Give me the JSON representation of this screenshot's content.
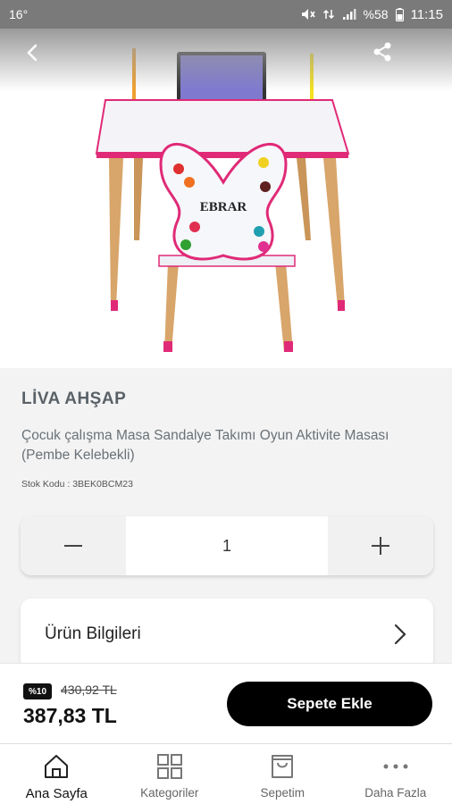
{
  "status_bar": {
    "temperature": "16°",
    "battery": "%58",
    "time": "11:15"
  },
  "product": {
    "brand": "LİVA AHŞAP",
    "name": "Çocuk çalışma Masa Sandalye Takımı Oyun Aktivite Masası (Pembe Kelebekli)",
    "stock_code": "Stok Kodu : 3BEK0BCM23",
    "image_text": "EBRAR"
  },
  "quantity": {
    "value": "1"
  },
  "details": {
    "label": "Ürün Bilgileri"
  },
  "price": {
    "discount": "%10",
    "old_price": "430,92 TL",
    "new_price": "387,83 TL"
  },
  "cart": {
    "button_label": "Sepete Ekle"
  },
  "nav": [
    {
      "label": "Ana Sayfa",
      "icon": "home-icon"
    },
    {
      "label": "Kategoriler",
      "icon": "grid-icon"
    },
    {
      "label": "Sepetim",
      "icon": "bag-icon"
    },
    {
      "label": "Daha Fazla",
      "icon": "more-icon"
    }
  ]
}
